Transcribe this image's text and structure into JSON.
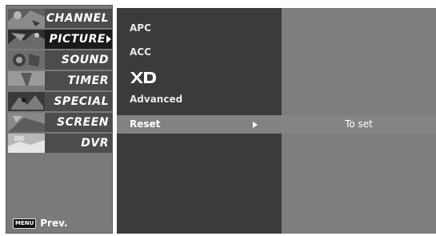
{
  "main_menu": {
    "items": [
      {
        "label": "CHANNEL",
        "icon": "channel-thumbnail-icon"
      },
      {
        "label": "PICTURE",
        "icon": "picture-thumbnail-icon",
        "active": true
      },
      {
        "label": "SOUND",
        "icon": "sound-thumbnail-icon"
      },
      {
        "label": "TIMER",
        "icon": "timer-thumbnail-icon"
      },
      {
        "label": "SPECIAL",
        "icon": "special-thumbnail-icon"
      },
      {
        "label": "SCREEN",
        "icon": "screen-thumbnail-icon"
      },
      {
        "label": "DVR",
        "icon": "dvr-thumbnail-icon"
      }
    ],
    "menu_key_label": "MENU",
    "prev_label": "Prev."
  },
  "picture_menu": {
    "items": {
      "apc": "APC",
      "acc": "ACC",
      "xd": "XD",
      "advanced": "Advanced",
      "reset": "Reset"
    },
    "selected": "Reset"
  },
  "detail": {
    "hint": "To set"
  },
  "colors": {
    "left_panel_bg": "#7a7a7a",
    "menu_item_bg": "#4c4c4c",
    "menu_item_active_bg": "#1a1a1a",
    "sub_panel_bg": "#3b3b3b",
    "selected_row_bg": "#828282",
    "detail_panel_bg": "#7e7e7e"
  }
}
